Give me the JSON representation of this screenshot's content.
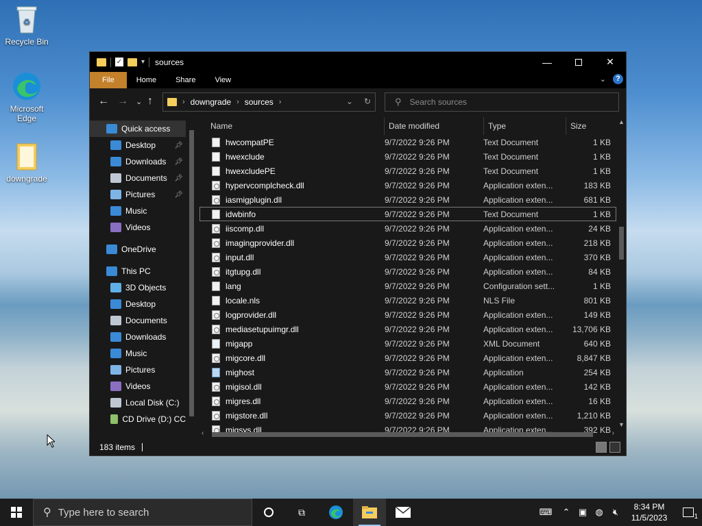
{
  "desktop": {
    "icons": [
      {
        "label": "Recycle Bin"
      },
      {
        "label": "Microsoft Edge"
      },
      {
        "label": "downgrade"
      }
    ]
  },
  "window": {
    "title": "sources",
    "ribbon_tabs": [
      "File",
      "Home",
      "Share",
      "View"
    ],
    "help_glyph": "?",
    "address": {
      "crumbs": [
        "downgrade",
        "sources"
      ]
    },
    "search_placeholder": "Search sources"
  },
  "nav_pane": {
    "items": [
      {
        "label": "Quick access",
        "icon": "star-icon",
        "level": 0,
        "selected": true
      },
      {
        "label": "Desktop",
        "icon": "desktop-icon",
        "level": 1,
        "pinned": true
      },
      {
        "label": "Downloads",
        "icon": "download-icon",
        "level": 1,
        "pinned": true
      },
      {
        "label": "Documents",
        "icon": "documents-icon",
        "level": 1,
        "pinned": true
      },
      {
        "label": "Pictures",
        "icon": "pictures-icon",
        "level": 1,
        "pinned": true
      },
      {
        "label": "Music",
        "icon": "music-icon",
        "level": 1
      },
      {
        "label": "Videos",
        "icon": "videos-icon",
        "level": 1
      },
      {
        "label": "OneDrive",
        "icon": "cloud-icon",
        "level": 0
      },
      {
        "label": "This PC",
        "icon": "pc-icon",
        "level": 0
      },
      {
        "label": "3D Objects",
        "icon": "cube-icon",
        "level": 1
      },
      {
        "label": "Desktop",
        "icon": "desktop-icon",
        "level": 1
      },
      {
        "label": "Documents",
        "icon": "documents-icon",
        "level": 1
      },
      {
        "label": "Downloads",
        "icon": "download-icon",
        "level": 1
      },
      {
        "label": "Music",
        "icon": "music-icon",
        "level": 1
      },
      {
        "label": "Pictures",
        "icon": "pictures-icon",
        "level": 1
      },
      {
        "label": "Videos",
        "icon": "videos-icon",
        "level": 1
      },
      {
        "label": "Local Disk (C:)",
        "icon": "disk-icon",
        "level": 1
      },
      {
        "label": "CD Drive (D:) CC",
        "icon": "cd-icon",
        "level": 1
      }
    ]
  },
  "files": {
    "columns": {
      "name": "Name",
      "date": "Date modified",
      "type": "Type",
      "size": "Size"
    },
    "rows": [
      {
        "name": "hwcompatPE",
        "date": "9/7/2022 9:26 PM",
        "type": "Text Document",
        "size": "1 KB",
        "icon": "txt"
      },
      {
        "name": "hwexclude",
        "date": "9/7/2022 9:26 PM",
        "type": "Text Document",
        "size": "1 KB",
        "icon": "txt"
      },
      {
        "name": "hwexcludePE",
        "date": "9/7/2022 9:26 PM",
        "type": "Text Document",
        "size": "1 KB",
        "icon": "txt"
      },
      {
        "name": "hypervcomplcheck.dll",
        "date": "9/7/2022 9:26 PM",
        "type": "Application exten...",
        "size": "183 KB",
        "icon": "dll"
      },
      {
        "name": "iasmigplugin.dll",
        "date": "9/7/2022 9:26 PM",
        "type": "Application exten...",
        "size": "681 KB",
        "icon": "dll"
      },
      {
        "name": "idwbinfo",
        "date": "9/7/2022 9:26 PM",
        "type": "Text Document",
        "size": "1 KB",
        "icon": "txt",
        "selected": true
      },
      {
        "name": "iiscomp.dll",
        "date": "9/7/2022 9:26 PM",
        "type": "Application exten...",
        "size": "24 KB",
        "icon": "dll"
      },
      {
        "name": "imagingprovider.dll",
        "date": "9/7/2022 9:26 PM",
        "type": "Application exten...",
        "size": "218 KB",
        "icon": "dll"
      },
      {
        "name": "input.dll",
        "date": "9/7/2022 9:26 PM",
        "type": "Application exten...",
        "size": "370 KB",
        "icon": "dll"
      },
      {
        "name": "itgtupg.dll",
        "date": "9/7/2022 9:26 PM",
        "type": "Application exten...",
        "size": "84 KB",
        "icon": "dll"
      },
      {
        "name": "lang",
        "date": "9/7/2022 9:26 PM",
        "type": "Configuration sett...",
        "size": "1 KB",
        "icon": "cfg"
      },
      {
        "name": "locale.nls",
        "date": "9/7/2022 9:26 PM",
        "type": "NLS File",
        "size": "801 KB",
        "icon": "txt"
      },
      {
        "name": "logprovider.dll",
        "date": "9/7/2022 9:26 PM",
        "type": "Application exten...",
        "size": "149 KB",
        "icon": "dll"
      },
      {
        "name": "mediasetupuimgr.dll",
        "date": "9/7/2022 9:26 PM",
        "type": "Application exten...",
        "size": "13,706 KB",
        "icon": "dll"
      },
      {
        "name": "migapp",
        "date": "9/7/2022 9:26 PM",
        "type": "XML Document",
        "size": "640 KB",
        "icon": "xml"
      },
      {
        "name": "migcore.dll",
        "date": "9/7/2022 9:26 PM",
        "type": "Application exten...",
        "size": "8,847 KB",
        "icon": "dll"
      },
      {
        "name": "mighost",
        "date": "9/7/2022 9:26 PM",
        "type": "Application",
        "size": "254 KB",
        "icon": "app"
      },
      {
        "name": "migisol.dll",
        "date": "9/7/2022 9:26 PM",
        "type": "Application exten...",
        "size": "142 KB",
        "icon": "dll"
      },
      {
        "name": "migres.dll",
        "date": "9/7/2022 9:26 PM",
        "type": "Application exten...",
        "size": "16 KB",
        "icon": "dll"
      },
      {
        "name": "migstore.dll",
        "date": "9/7/2022 9:26 PM",
        "type": "Application exten...",
        "size": "1,210 KB",
        "icon": "dll"
      },
      {
        "name": "migsys.dll",
        "date": "9/7/2022 9:26 PM",
        "type": "Application exten...",
        "size": "392 KB",
        "icon": "dll"
      }
    ]
  },
  "status": {
    "item_count": "183 items"
  },
  "taskbar": {
    "search_placeholder": "Type here to search",
    "time": "8:34 PM",
    "date": "11/5/2023",
    "notification_count": "1"
  },
  "colors": {
    "file_tab": "#c2812a",
    "folder": "#f4cd5c",
    "window_bg": "#191919",
    "taskbar_bg": "#1c1c1c"
  }
}
